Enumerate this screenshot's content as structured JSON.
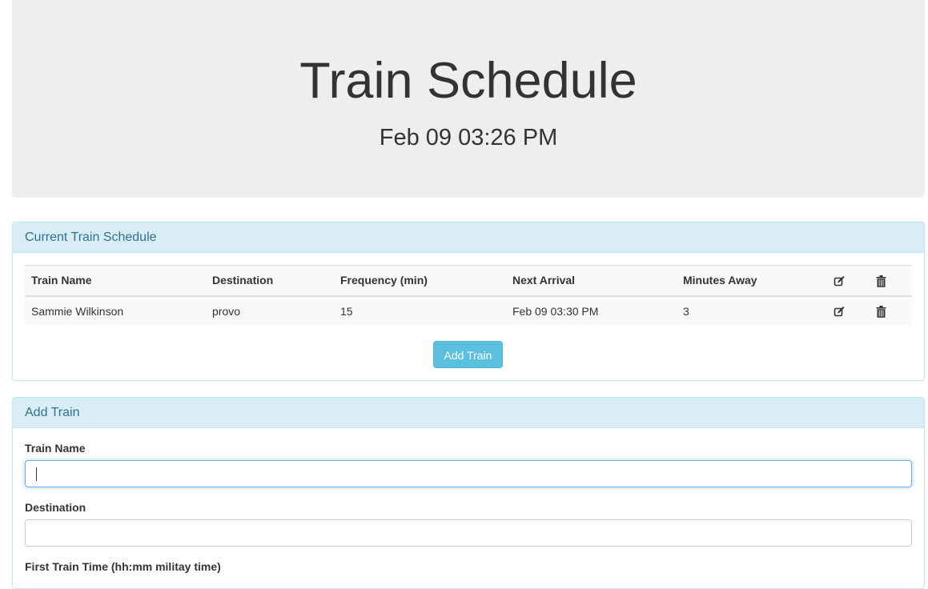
{
  "header": {
    "title": "Train Schedule",
    "current_time": "Feb 09 03:26 PM"
  },
  "schedule": {
    "panel_title": "Current Train Schedule",
    "columns": [
      "Train Name",
      "Destination",
      "Frequency (min)",
      "Next Arrival",
      "Minutes Away"
    ],
    "rows": [
      {
        "train_name": "Sammie Wilkinson",
        "destination": "provo",
        "frequency": "15",
        "next_arrival": "Feb 09 03:30 PM",
        "minutes_away": "3"
      }
    ],
    "add_button_label": "Add Train",
    "icons": {
      "edit": "edit-icon",
      "delete": "trash-icon"
    }
  },
  "add_form": {
    "panel_title": "Add Train",
    "fields": [
      {
        "label": "Train Name",
        "value": ""
      },
      {
        "label": "Destination",
        "value": ""
      },
      {
        "label": "First Train Time (hh:mm militay time)",
        "value": ""
      }
    ]
  },
  "colors": {
    "jumbotron_bg": "#eeeeee",
    "panel_heading_bg": "#d9edf7",
    "panel_heading_text": "#31708f",
    "panel_border": "#bce8f1",
    "button_info": "#5bc0de",
    "focus_border": "#66afe9"
  }
}
